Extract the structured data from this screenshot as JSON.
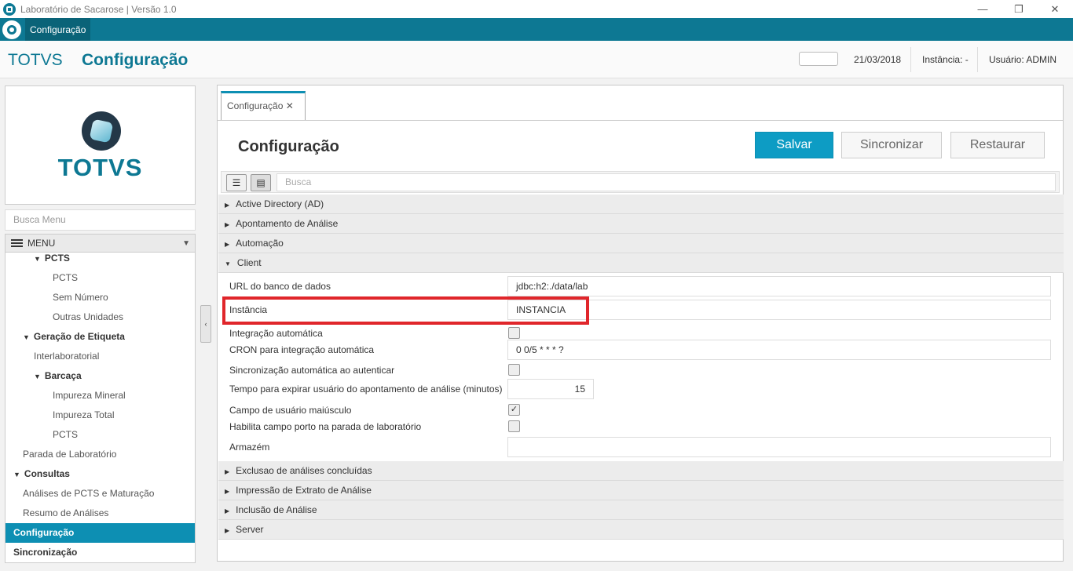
{
  "window": {
    "title": "Laboratório de Sacarose | Versão 1.0",
    "minimize": "—",
    "restore": "❐",
    "close": "✕"
  },
  "menubar": {
    "tab_label": "Configuração"
  },
  "header": {
    "brand": "TOTVS",
    "title": "Configuração",
    "date": "21/03/2018",
    "instance": "Instância: -",
    "user": "Usuário: ADMIN"
  },
  "logo": {
    "wordmark": "TOTVS"
  },
  "sidebar": {
    "search_placeholder": "Busca Menu",
    "menu_label": "MENU",
    "items": [
      {
        "label": "PCTS",
        "level": 2,
        "arrow": "▼",
        "bold": true
      },
      {
        "label": "PCTS",
        "level": 3
      },
      {
        "label": "Sem Número",
        "level": 3
      },
      {
        "label": "Outras Unidades",
        "level": 3
      },
      {
        "label": "Geração de Etiqueta",
        "level": 1,
        "arrow": "▼",
        "bold": true
      },
      {
        "label": "Interlaboratorial",
        "level": 2
      },
      {
        "label": "Barcaça",
        "level": 2,
        "arrow": "▼",
        "bold": true
      },
      {
        "label": "Impureza Mineral",
        "level": 3
      },
      {
        "label": "Impureza Total",
        "level": 3
      },
      {
        "label": "PCTS",
        "level": 3
      },
      {
        "label": "Parada de Laboratório",
        "level": 1
      },
      {
        "label": "Consultas",
        "level": 0,
        "arrow": "▼",
        "bold": true
      },
      {
        "label": "Análises de PCTS e Maturação",
        "level": 1
      },
      {
        "label": "Resumo de Análises",
        "level": 1
      },
      {
        "label": "Configuração",
        "level": 0,
        "bold": true,
        "active": true
      },
      {
        "label": "Sincronização",
        "level": 0,
        "bold": true
      }
    ]
  },
  "collapse_glyph": "‹",
  "main": {
    "tab_label": "Configuração ✕",
    "title": "Configuração",
    "buttons": {
      "save": "Salvar",
      "sync": "Sincronizar",
      "restore": "Restaurar"
    },
    "search_placeholder": "Busca",
    "sections_before": [
      "Active Directory (AD)",
      "Apontamento de Análise",
      "Automação"
    ],
    "client_section": "Client",
    "fields": [
      {
        "label": "URL do banco de dados",
        "type": "text",
        "value": "jdbc:h2:./data/lab"
      },
      {
        "label": "Instância",
        "type": "text",
        "value": "INSTANCIA"
      },
      {
        "label": "Integração automática",
        "type": "checkbox",
        "checked": false
      },
      {
        "label": "CRON para integração automática",
        "type": "text",
        "value": "0 0/5 * * * ?"
      },
      {
        "label": "Sincronização automática ao autenticar",
        "type": "checkbox",
        "checked": false
      },
      {
        "label": "Tempo para expirar usuário do apontamento de análise (minutos)",
        "type": "number",
        "value": "15"
      },
      {
        "label": "Campo de usuário maiúsculo",
        "type": "checkbox",
        "checked": true,
        "mark": "✓"
      },
      {
        "label": "Habilita campo porto na parada de laboratório",
        "type": "checkbox",
        "checked": false
      },
      {
        "label": "Armazém",
        "type": "text",
        "value": ""
      }
    ],
    "sections_after": [
      "Exclusao de análises concluídas",
      "Impressão de Extrato de Análise",
      "Inclusão de Análise",
      "Server"
    ]
  },
  "colors": {
    "brand": "#0d7893",
    "accent": "#0d9cc4",
    "highlight": "#e0262b"
  }
}
